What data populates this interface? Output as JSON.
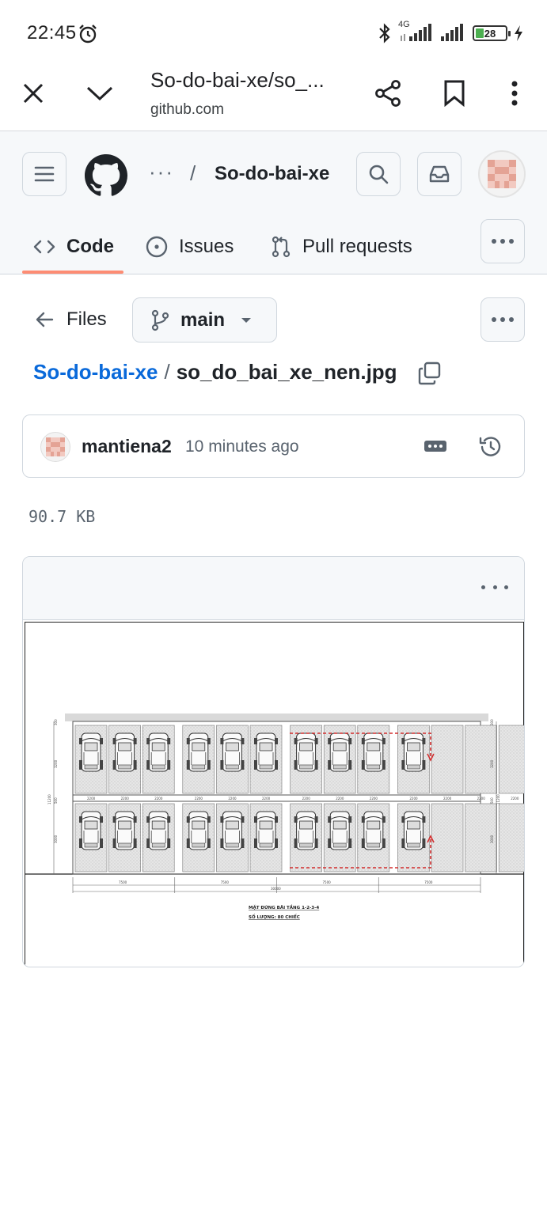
{
  "status_bar": {
    "time": "22:45",
    "network": "4G",
    "battery": "28"
  },
  "browser": {
    "title": "So-do-bai-xe/so_...",
    "url": "github.com",
    "icons": [
      "close-icon",
      "chevron-down-icon",
      "share-icon",
      "bookmark-icon",
      "more-vert-icon"
    ]
  },
  "github": {
    "breadcrumb_dots": "···",
    "breadcrumb_sep": "/",
    "repo_name": "So-do-bai-xe",
    "tabs": [
      {
        "label": "Code",
        "icon": "code-icon",
        "active": true
      },
      {
        "label": "Issues",
        "icon": "issue-icon",
        "active": false
      },
      {
        "label": "Pull requests",
        "icon": "pull-request-icon",
        "active": false
      }
    ],
    "accent_color": "#fd8c73",
    "link_color": "#0969da"
  },
  "file_nav": {
    "files_label": "Files",
    "branch": "main"
  },
  "path": {
    "repo": "So-do-bai-xe",
    "separator": "/",
    "file": "so_do_bai_xe_nen.jpg"
  },
  "commit": {
    "user": "mantiena2",
    "time": "10 minutes ago"
  },
  "file_size": "90.7 KB",
  "drawing": {
    "title_line1": "MẶT ĐỨNG BÃI TẦNG 1-2-3-4",
    "title_line2": "SỐ LƯỢNG: 80 CHIẾC",
    "dim_bay": "2200",
    "dim_section": "7500",
    "dim_total": "30000",
    "dim_side_a": "3200",
    "dim_side_b": "3000",
    "dim_small": "300",
    "dim_mid": "500",
    "dim_height": "11200"
  }
}
